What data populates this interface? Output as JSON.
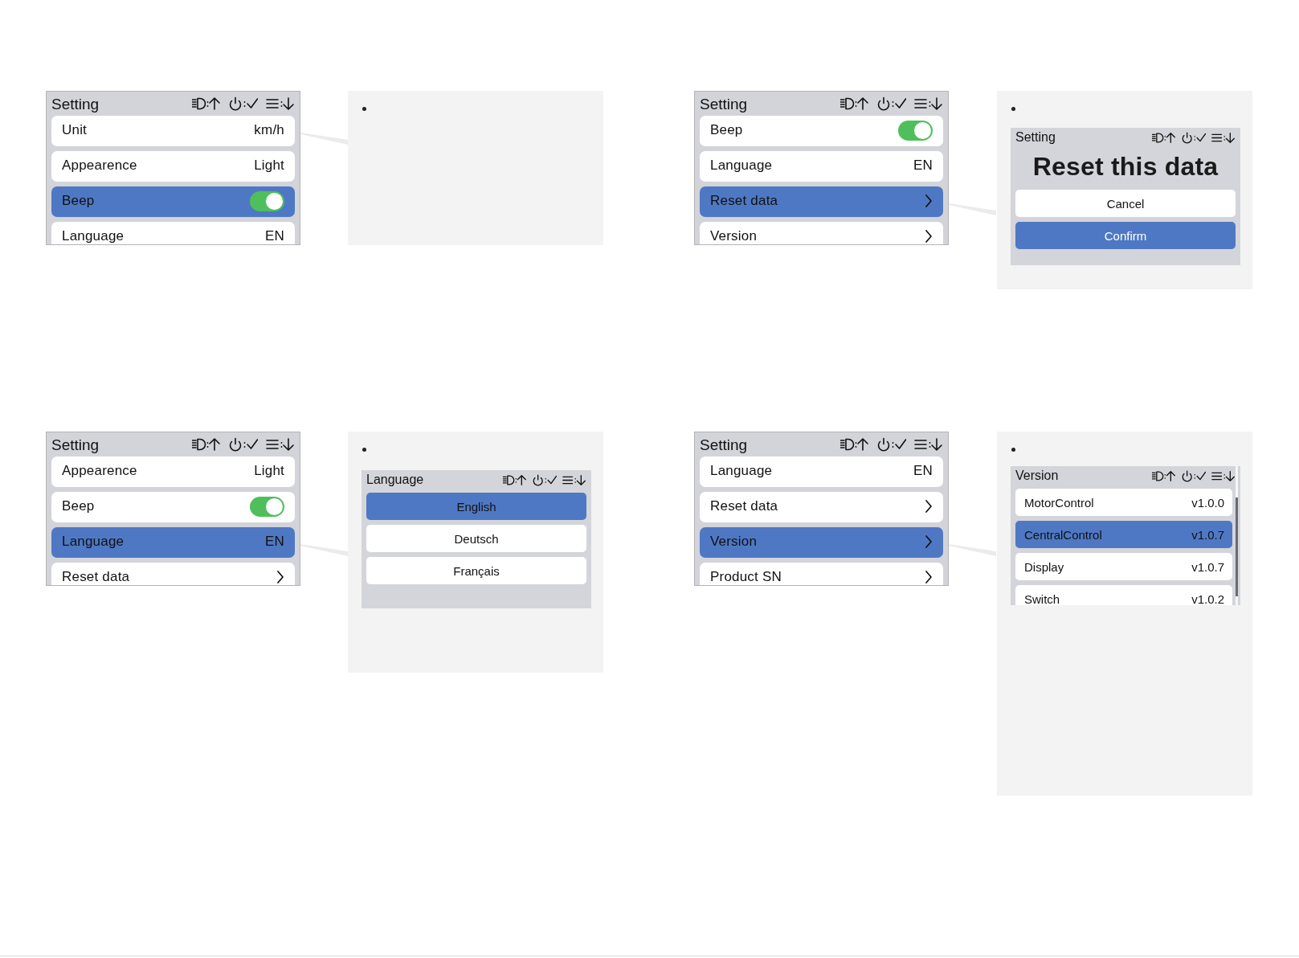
{
  "boards": [
    {
      "screen": {
        "title": "Setting",
        "rows": [
          {
            "label": "Unit",
            "kind": "value",
            "value": "km/h",
            "selected": false
          },
          {
            "label": "Appearence",
            "kind": "value",
            "value": "Light",
            "selected": false
          },
          {
            "label": "Beep",
            "kind": "toggle",
            "on": true,
            "selected": true
          },
          {
            "label": "Language",
            "kind": "value",
            "value": "EN",
            "selected": false
          }
        ]
      },
      "note": {
        "kind": "blank"
      }
    },
    {
      "screen": {
        "title": "Setting",
        "rows": [
          {
            "label": "Beep",
            "kind": "toggle",
            "on": true,
            "selected": false
          },
          {
            "label": "Language",
            "kind": "value",
            "value": "EN",
            "selected": false
          },
          {
            "label": "Reset data",
            "kind": "link",
            "selected": true
          },
          {
            "label": "Version",
            "kind": "link",
            "selected": false
          }
        ]
      },
      "note": {
        "kind": "dialog",
        "title": "Setting",
        "heading": "Reset this data",
        "buttons": [
          {
            "label": "Cancel",
            "selected": false
          },
          {
            "label": "Confirm",
            "selected": true
          }
        ]
      }
    },
    {
      "screen": {
        "title": "Setting",
        "rows": [
          {
            "label": "Appearence",
            "kind": "value",
            "value": "Light",
            "selected": false
          },
          {
            "label": "Beep",
            "kind": "toggle",
            "on": true,
            "selected": false
          },
          {
            "label": "Language",
            "kind": "value",
            "value": "EN",
            "selected": true
          },
          {
            "label": "Reset data",
            "kind": "link",
            "selected": false
          }
        ]
      },
      "note": {
        "kind": "options",
        "title": "Language",
        "options": [
          {
            "label": "English",
            "selected": true
          },
          {
            "label": "Deutsch",
            "selected": false
          },
          {
            "label": "Français",
            "selected": false
          }
        ]
      }
    },
    {
      "screen": {
        "title": "Setting",
        "rows": [
          {
            "label": "Language",
            "kind": "value",
            "value": "EN",
            "selected": false
          },
          {
            "label": "Reset data",
            "kind": "link",
            "selected": false
          },
          {
            "label": "Version",
            "kind": "link",
            "selected": true
          },
          {
            "label": "Product SN",
            "kind": "link",
            "selected": false
          }
        ]
      },
      "note": {
        "kind": "list",
        "title": "Version",
        "rows": [
          {
            "label": "MotorControl",
            "value": "v1.0.0",
            "selected": false
          },
          {
            "label": "CentralControl",
            "value": "v1.0.7",
            "selected": true
          },
          {
            "label": "Display",
            "value": "v1.0.7",
            "selected": false
          },
          {
            "label": "Switch",
            "value": "v1.0.2",
            "selected": false
          }
        ]
      }
    }
  ]
}
